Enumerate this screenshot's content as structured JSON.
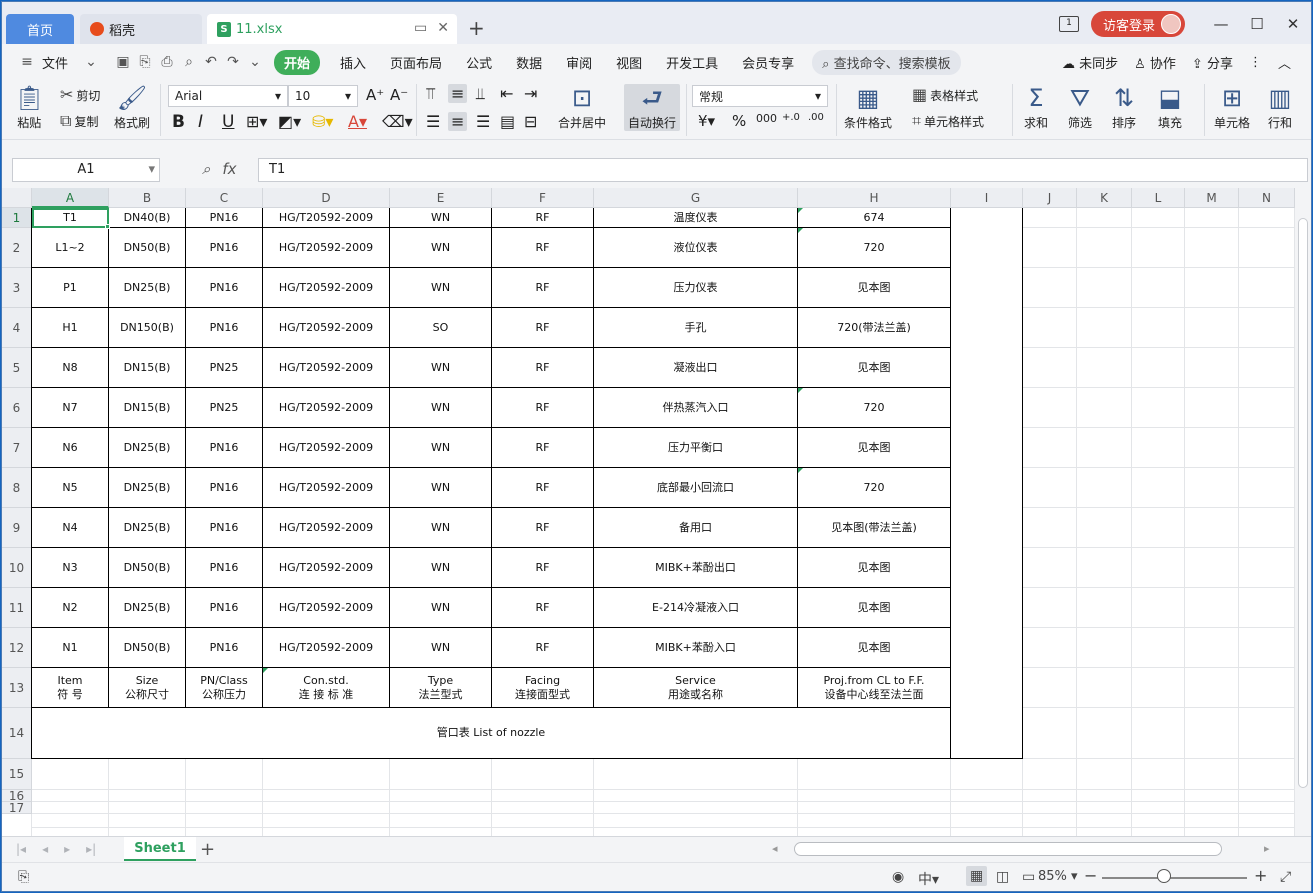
{
  "tabs": {
    "home": "首页",
    "docer": "稻壳",
    "file": "11.xlsx"
  },
  "title_right": {
    "workspace_count": "1",
    "login": "访客登录"
  },
  "menu": {
    "file": "文件",
    "items": [
      "开始",
      "插入",
      "页面布局",
      "公式",
      "数据",
      "审阅",
      "视图",
      "开发工具",
      "会员专享"
    ],
    "search": "查找命令、搜索模板",
    "sync": "未同步",
    "collab": "协作",
    "share": "分享"
  },
  "ribbon": {
    "paste": "粘贴",
    "cut": "剪切",
    "copy": "复制",
    "format_painter": "格式刷",
    "font_name": "Arial",
    "font_size": "10",
    "merge": "合并居中",
    "wrap": "自动换行",
    "number_format": "常规",
    "cond_format": "条件格式",
    "table_style": "表格样式",
    "cell_style": "单元格样式",
    "sum": "求和",
    "filter": "筛选",
    "sort": "排序",
    "fill": "填充",
    "cell": "单元格",
    "rowcol": "行和"
  },
  "formula_bar": {
    "name_box": "A1",
    "formula": "T1"
  },
  "columns": [
    "A",
    "B",
    "C",
    "D",
    "E",
    "F",
    "G",
    "H",
    "I",
    "J",
    "K",
    "L",
    "M",
    "N"
  ],
  "rows": [
    "1",
    "2",
    "3",
    "4",
    "5",
    "6",
    "7",
    "8",
    "9",
    "10",
    "11",
    "12",
    "13",
    "14",
    "15",
    "16",
    "17"
  ],
  "table": {
    "data_rows": [
      [
        "T1",
        "DN40(B)",
        "PN16",
        "HG/T20592-2009",
        "WN",
        "RF",
        "温度仪表",
        "674"
      ],
      [
        "L1~2",
        "DN50(B)",
        "PN16",
        "HG/T20592-2009",
        "WN",
        "RF",
        "液位仪表",
        "720"
      ],
      [
        "P1",
        "DN25(B)",
        "PN16",
        "HG/T20592-2009",
        "WN",
        "RF",
        "压力仪表",
        "见本图"
      ],
      [
        "H1",
        "DN150(B)",
        "PN16",
        "HG/T20592-2009",
        "SO",
        "RF",
        "手孔",
        "720(带法兰盖)"
      ],
      [
        "N8",
        "DN15(B)",
        "PN25",
        "HG/T20592-2009",
        "WN",
        "RF",
        "凝液出口",
        "见本图"
      ],
      [
        "N7",
        "DN15(B)",
        "PN25",
        "HG/T20592-2009",
        "WN",
        "RF",
        "伴热蒸汽入口",
        "720"
      ],
      [
        "N6",
        "DN25(B)",
        "PN16",
        "HG/T20592-2009",
        "WN",
        "RF",
        "压力平衡口",
        "见本图"
      ],
      [
        "N5",
        "DN25(B)",
        "PN16",
        "HG/T20592-2009",
        "WN",
        "RF",
        "底部最小回流口",
        "720"
      ],
      [
        "N4",
        "DN25(B)",
        "PN16",
        "HG/T20592-2009",
        "WN",
        "RF",
        "备用口",
        "见本图(带法兰盖)"
      ],
      [
        "N3",
        "DN50(B)",
        "PN16",
        "HG/T20592-2009",
        "WN",
        "RF",
        "MIBK+苯酚出口",
        "见本图"
      ],
      [
        "N2",
        "DN25(B)",
        "PN16",
        "HG/T20592-2009",
        "WN",
        "RF",
        "E-214冷凝液入口",
        "见本图"
      ],
      [
        "N1",
        "DN50(B)",
        "PN16",
        "HG/T20592-2009",
        "WN",
        "RF",
        "MIBK+苯酚入口",
        "见本图"
      ]
    ],
    "header_row": [
      [
        "Item",
        "符 号"
      ],
      [
        "Size",
        "公称尺寸"
      ],
      [
        "PN/Class",
        "公称压力"
      ],
      [
        "Con.std.",
        "连 接 标 准"
      ],
      [
        "Type",
        "法兰型式"
      ],
      [
        "Facing",
        "连接面型式"
      ],
      [
        "Service",
        "用途或名称"
      ],
      [
        "Proj.from CL to F.F.",
        "设备中心线至法兰面"
      ]
    ],
    "caption": "管口表 List of nozzle"
  },
  "sheet": {
    "name": "Sheet1"
  },
  "status": {
    "zoom": "85%"
  },
  "colors": {
    "accent": "#2ea05f",
    "home_tab": "#4f8ae0",
    "login": "#d8473a"
  }
}
